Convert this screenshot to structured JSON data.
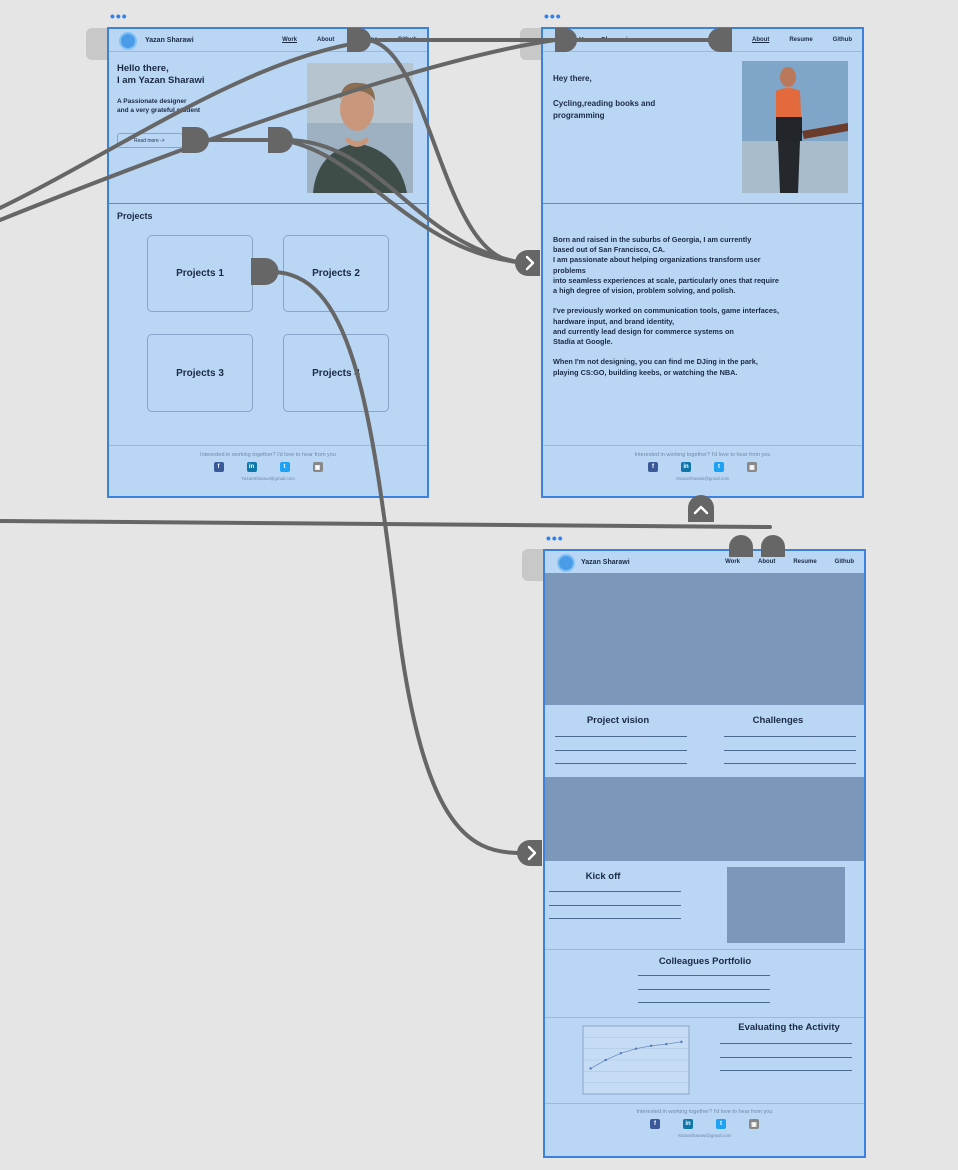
{
  "frame_menu_dots": "•••",
  "nav": {
    "brand": "Yazan Sharawi",
    "links": [
      "Work",
      "About",
      "Resume",
      "Github"
    ]
  },
  "home": {
    "greeting_line1": "Hello there,",
    "greeting_line2": "I am Yazan Sharawi",
    "tagline_line1": "A Passionate designer",
    "tagline_line2": "and a very grateful student",
    "read_more": "Read more ->",
    "projects_heading": "Projects",
    "projects": [
      "Projects 1",
      "Projects 2",
      "Projects 3",
      "Projects 4"
    ]
  },
  "about": {
    "hey": "Hey there,",
    "hobbies_line1": "Cycling,reading books and",
    "hobbies_line2": "programming",
    "bio": "Born and raised in the suburbs of Georgia, I am currently\nbased out of San Francisco, CA.\nI am passionate about helping organizations transform user\nproblems\ninto seamless experiences at scale, particularly ones that require\na high degree of vision, problem solving, and polish.\n\nI've previously worked on communication tools, game interfaces,\nhardware input, and brand identity,\nand currently lead design for commerce systems on\nStadia at Google.\n\nWhen I'm not designing, you can find me DJing in the park,\nplaying CS:GO, building keebs, or watching the NBA."
  },
  "project": {
    "vision": "Project vision",
    "challenges": "Challenges",
    "kickoff": "Kick off",
    "colleagues": "Colleagues Portfolio",
    "evaluating": "Evaluating the Activity"
  },
  "footer": {
    "question": "Interested in working together? I'd love to hear from you",
    "email": "YazanSharawi@gmail.com",
    "social_icons": [
      "facebook-icon",
      "linkedin-icon",
      "twitter-icon",
      "instagram-icon"
    ],
    "social_glyphs": [
      "f",
      "in",
      "t",
      "▣"
    ]
  },
  "colors": {
    "frame_fill": "#bad6f5",
    "frame_border": "#3b82e0",
    "placeholder_block": "#7b98bb",
    "wire": "#666666"
  },
  "chart_data": {
    "type": "line",
    "x": [
      1,
      2,
      3,
      4,
      5,
      6,
      7
    ],
    "series": [
      {
        "values": [
          45,
          60,
          72,
          80,
          85,
          88,
          92
        ]
      }
    ],
    "ylim": [
      0,
      120
    ],
    "grid": true
  }
}
